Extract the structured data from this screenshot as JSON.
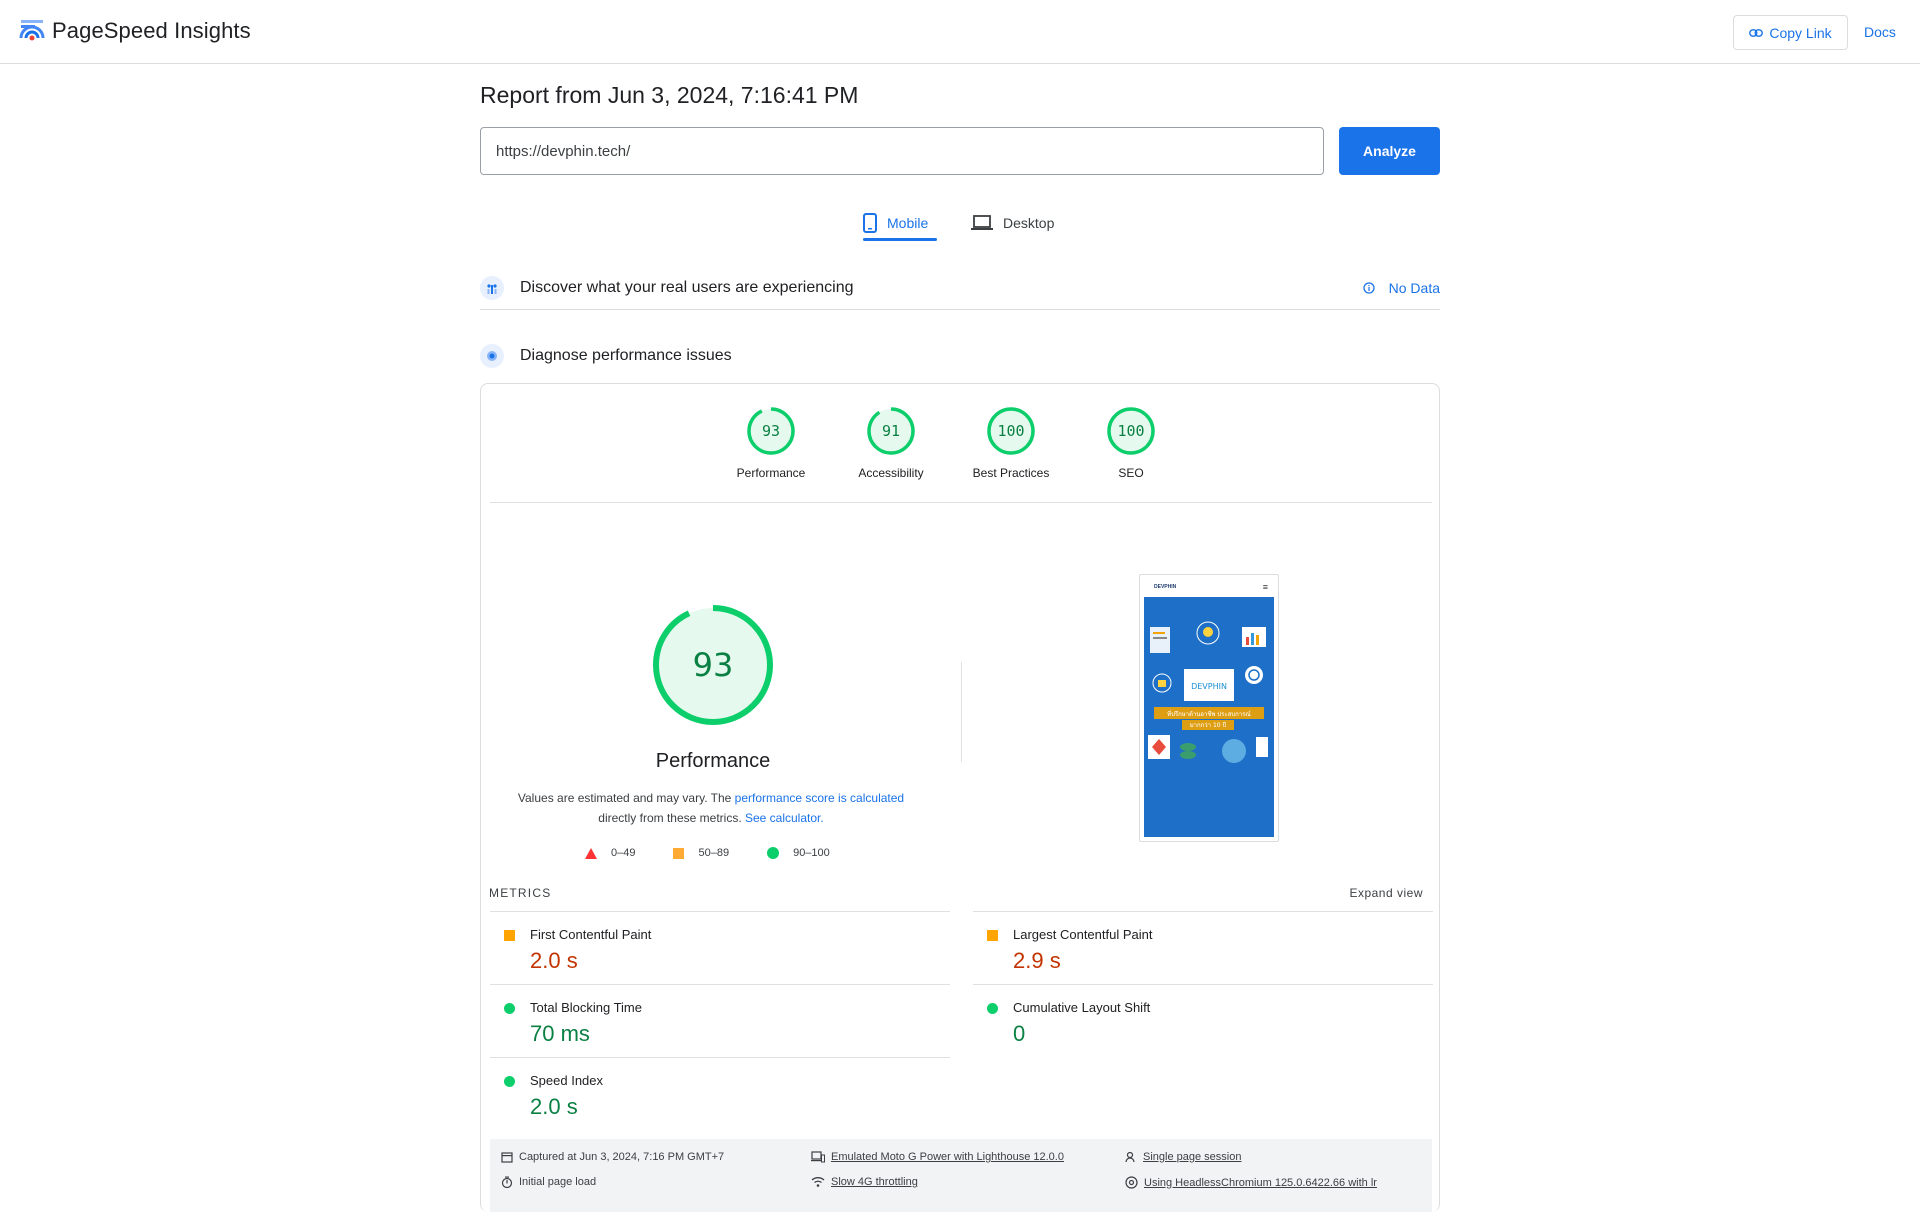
{
  "header": {
    "brand": "PageSpeed Insights",
    "copy_link": "Copy Link",
    "docs": "Docs"
  },
  "report": {
    "title": "Report from Jun 3, 2024, 7:16:41 PM",
    "url": "https://devphin.tech/",
    "analyze": "Analyze"
  },
  "tabs": [
    {
      "label": "Mobile",
      "selected": true
    },
    {
      "label": "Desktop",
      "selected": false
    }
  ],
  "real_users": {
    "title": "Discover what your real users are experiencing",
    "status": "No Data"
  },
  "diagnose": {
    "title": "Diagnose performance issues"
  },
  "scores": [
    {
      "label": "Performance",
      "value": 93
    },
    {
      "label": "Accessibility",
      "value": 91
    },
    {
      "label": "Best Practices",
      "value": 100
    },
    {
      "label": "SEO",
      "value": 100
    }
  ],
  "performance": {
    "score": "93",
    "label": "Performance",
    "note_prefix": "Values are estimated and may vary. The ",
    "note_link1": "performance score is calculated",
    "note_mid": "directly from these metrics. ",
    "note_link2": "See calculator."
  },
  "legend": [
    {
      "range": "0–49",
      "color": "#ff3333",
      "shape": "triangle"
    },
    {
      "range": "50–89",
      "color": "#ffaa33",
      "shape": "square"
    },
    {
      "range": "90–100",
      "color": "#0cce6b",
      "shape": "circle"
    }
  ],
  "screenshot": {
    "site_name": "DEVPHIN",
    "logo_text": "DEVPHIN",
    "tagline_1": "ที่ปรึกษาด้านอาชีพ ประสบการณ์",
    "tagline_2": "มากกว่า 10 ปี"
  },
  "metrics_section": {
    "title": "METRICS",
    "expand": "Expand view"
  },
  "metrics": [
    {
      "name": "First Contentful Paint",
      "value": "2.0 s",
      "rating": "average"
    },
    {
      "name": "Largest Contentful Paint",
      "value": "2.9 s",
      "rating": "average"
    },
    {
      "name": "Total Blocking Time",
      "value": "70 ms",
      "rating": "good"
    },
    {
      "name": "Cumulative Layout Shift",
      "value": "0",
      "rating": "good"
    },
    {
      "name": "Speed Index",
      "value": "2.0 s",
      "rating": "good"
    }
  ],
  "footer": {
    "captured": "Captured at Jun 3, 2024, 7:16 PM GMT+7",
    "initial": "Initial page load",
    "device": "Emulated Moto G Power with Lighthouse 12.0.0",
    "throttle": "Slow 4G throttling",
    "session": "Single page session",
    "browser": "Using HeadlessChromium 125.0.6422.66 with lr"
  },
  "colors": {
    "accent": "#1a73e8",
    "pass": "#0cce6b",
    "pass_text": "#0b8043",
    "average": "#ffa400",
    "average_text": "#c33300"
  }
}
